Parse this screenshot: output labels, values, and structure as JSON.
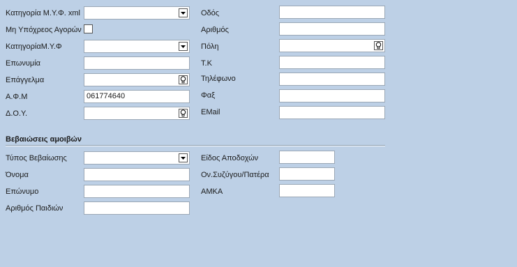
{
  "left": {
    "kategoria_myf_xml": {
      "label": "Κατηγορία Μ.Υ.Φ. xml",
      "value": ""
    },
    "mi_ypoxreos": {
      "label": "Μη Υπόχρεος Αγορών"
    },
    "kategoria_myf": {
      "label": "ΚατηγορίαΜ.Υ.Φ",
      "value": ""
    },
    "eponymia": {
      "label": "Επωνυμία",
      "value": ""
    },
    "epaggelma": {
      "label": "Επάγγελμα",
      "value": ""
    },
    "afm": {
      "label": "Α.Φ.Μ",
      "value": "061774640"
    },
    "doy": {
      "label": "Δ.Ο.Υ.",
      "value": ""
    }
  },
  "right": {
    "odos": {
      "label": "Οδός",
      "value": ""
    },
    "arithmos": {
      "label": "Αριθμός",
      "value": ""
    },
    "poli": {
      "label": "Πόλη",
      "value": ""
    },
    "tk": {
      "label": "Τ.Κ",
      "value": ""
    },
    "tilefono": {
      "label": "Τηλέφωνο",
      "value": ""
    },
    "fax": {
      "label": "Φαξ",
      "value": ""
    },
    "email": {
      "label": "EMail",
      "value": ""
    }
  },
  "section": {
    "title": "Βεβαιώσεις αμοιβών",
    "typos": {
      "label": "Τύπος Βεβαίωσης",
      "value": ""
    },
    "onoma": {
      "label": "Όνομα",
      "value": ""
    },
    "eponymo": {
      "label": "Επώνυμο",
      "value": ""
    },
    "paidia": {
      "label": "Αριθμός Παιδιών",
      "value": ""
    },
    "eidos": {
      "label": "Είδος Αποδοχών",
      "value": ""
    },
    "syzygou": {
      "label": "Ον.Συζύγου/Πατέρα",
      "value": ""
    },
    "amka": {
      "label": "ΑΜΚΑ",
      "value": ""
    }
  },
  "icons": {
    "dropdown": "chevron-down-icon",
    "lookup": "lightbulb-icon"
  }
}
